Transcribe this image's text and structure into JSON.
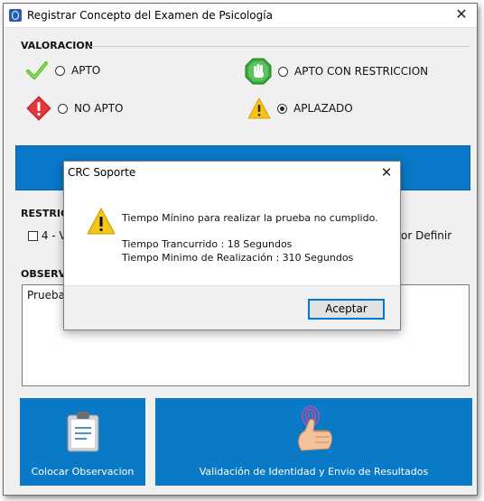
{
  "window": {
    "title": "Registrar Concepto del Examen de Psicología",
    "close_glyph": "✕"
  },
  "valoracion": {
    "label": "VALORACION",
    "options": [
      {
        "label": "APTO",
        "icon": "green-check-icon",
        "selected": false
      },
      {
        "label": "APTO CON RESTRICCION",
        "icon": "green-hand-stop-icon",
        "selected": false
      },
      {
        "label": "NO APTO",
        "icon": "red-diamond-warning-icon",
        "selected": false
      },
      {
        "label": "APLAZADO",
        "icon": "yellow-triangle-warning-icon",
        "selected": true
      }
    ]
  },
  "restricciones": {
    "label_visible": "RESTRICC",
    "item_visible": "4 - V",
    "right_text_visible": "or Definir"
  },
  "observaciones": {
    "label_visible": "OBSERVA",
    "value": "Prueba"
  },
  "buttons": {
    "colocar": "Colocar Observacion",
    "validacion": "Validación de Identidad y Envio de Resultados"
  },
  "dialog": {
    "title": "CRC Soporte",
    "close_glyph": "✕",
    "message_line1": "Tiempo Mínino para realizar la prueba no cumplido.",
    "message_line2": "Tiempo Trancurrido : 18 Segundos",
    "message_line3": "Tiempo Minimo de Realización : 310 Segundos",
    "ok_label": "Aceptar",
    "icon": "warning-triangle-icon"
  },
  "colors": {
    "accent_blue": "#0b7ac6",
    "dialog_focus": "#0078d7",
    "warning_yellow": "#f5c518"
  }
}
